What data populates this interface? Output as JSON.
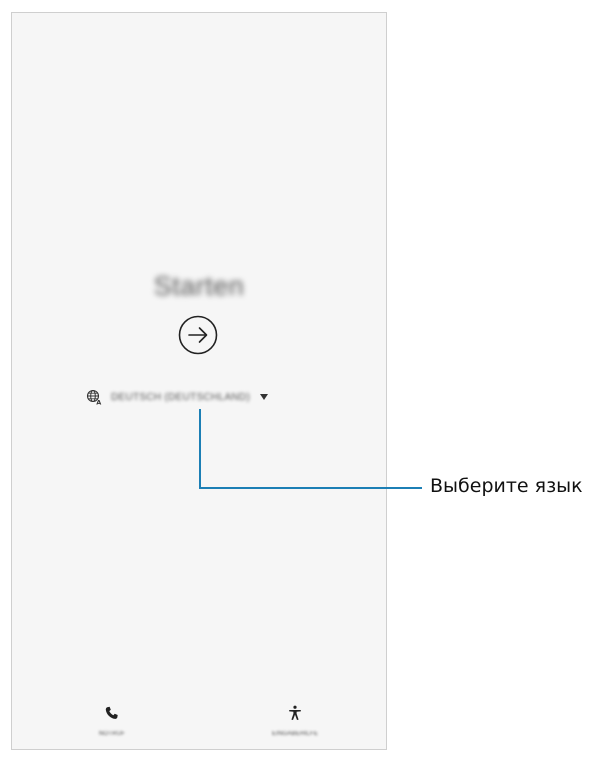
{
  "screen": {
    "title": "Starten",
    "start_button_icon": "arrow-right-circle-icon",
    "language": {
      "icon": "globe-icon",
      "selected": "DEUTSCH (DEUTSCHLAND)"
    },
    "bottom_actions": {
      "emergency": {
        "icon": "phone-icon",
        "label": "NOTRUF"
      },
      "accessibility": {
        "icon": "accessibility-icon",
        "label": "EINGABEHILFE"
      }
    }
  },
  "annotation": {
    "text": "Выберите язык",
    "line_color": "#1c7fb5"
  }
}
